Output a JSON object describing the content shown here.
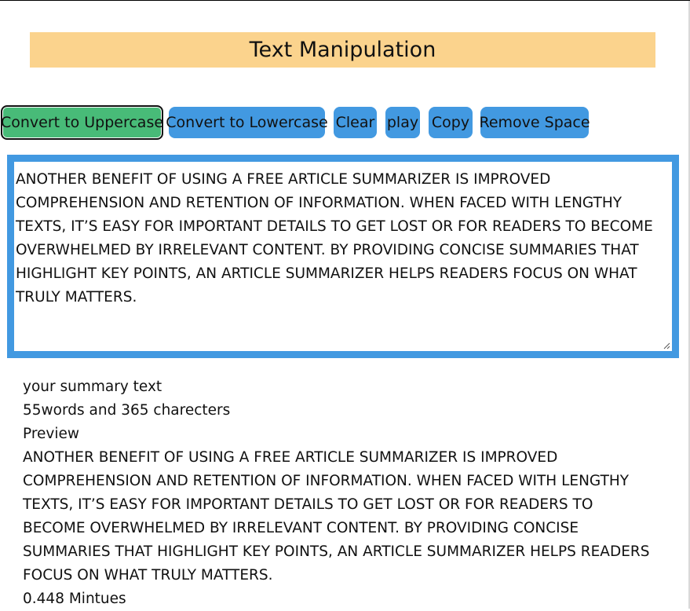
{
  "header": {
    "title": "Text Manipulation"
  },
  "toolbar": {
    "uppercase_label": "Convert to Uppercase",
    "lowercase_label": "Convert to Lowercase",
    "clear_label": "Clear",
    "play_label": "play",
    "copy_label": "Copy",
    "remove_space_label": "Remove Space"
  },
  "editor": {
    "value": " ANOTHER BENEFIT OF USING A FREE ARTICLE SUMMARIZER IS IMPROVED COMPREHENSION AND RETENTION OF INFORMATION. WHEN FACED WITH LENGTHY TEXTS, IT’S EASY FOR IMPORTANT DETAILS TO GET LOST OR FOR READERS TO BECOME OVERWHELMED BY IRRELEVANT CONTENT. BY PROVIDING CONCISE SUMMARIES THAT HIGHLIGHT KEY POINTS, AN ARTICLE SUMMARIZER HELPS READERS FOCUS ON WHAT TRULY MATTERS."
  },
  "summary": {
    "heading": "your summary text",
    "counts": "55words and 365 charecters",
    "preview_label": "Preview",
    "preview_text": "ANOTHER BENEFIT OF USING A FREE ARTICLE SUMMARIZER IS IMPROVED COMPREHENSION AND RETENTION OF INFORMATION. WHEN FACED WITH LENGTHY TEXTS, IT’S EASY FOR IMPORTANT DETAILS TO GET LOST OR FOR READERS TO BECOME OVERWHELMED BY IRRELEVANT CONTENT. BY PROVIDING CONCISE SUMMARIES THAT HIGHLIGHT KEY POINTS, AN ARTICLE SUMMARIZER HELPS READERS FOCUS ON WHAT TRULY MATTERS.",
    "read_time": "0.448 Mintues"
  },
  "colors": {
    "title_bg": "#fbd38d",
    "button_blue": "#4299e1",
    "button_green": "#48bb78",
    "editor_border": "#4299e1"
  },
  "icons": {
    "resize_grip": "resize-grip-icon"
  }
}
